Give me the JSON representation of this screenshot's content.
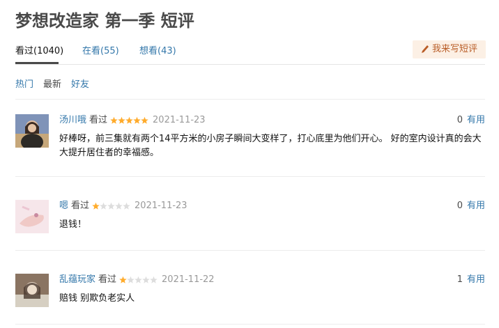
{
  "page": {
    "title": "梦想改造家 第一季 短评"
  },
  "tabs": [
    {
      "label": "看过(1040)"
    },
    {
      "label": "在看(55)"
    },
    {
      "label": "想看(43)"
    }
  ],
  "write_button": {
    "label": "我来写短评"
  },
  "sort": [
    {
      "label": "热门"
    },
    {
      "label": "最新"
    },
    {
      "label": "好友"
    }
  ],
  "comments": [
    {
      "user": "汤川哦",
      "status": "看过",
      "rating": 5,
      "date": "2021-11-23",
      "useful_count": "0",
      "useful_label": "有用",
      "content": "好棒呀，前三集就有两个14平方米的小房子瞬间大变样了，打心底里为他们开心。 好的室内设计真的会大大提升居住者的幸福感。"
    },
    {
      "user": "嗯",
      "status": "看过",
      "rating": 1,
      "date": "2021-11-23",
      "useful_count": "0",
      "useful_label": "有用",
      "content": "退钱！"
    },
    {
      "user": "乱蕴玩家",
      "status": "看过",
      "rating": 1,
      "date": "2021-11-22",
      "useful_count": "1",
      "useful_label": "有用",
      "content": "赔钱 别欺负老实人"
    }
  ],
  "colors": {
    "link": "#3377aa",
    "star": "#ffac2d",
    "star_empty": "#dddddd",
    "write_bg": "#fcf0e5",
    "write_text": "#b95c26"
  }
}
